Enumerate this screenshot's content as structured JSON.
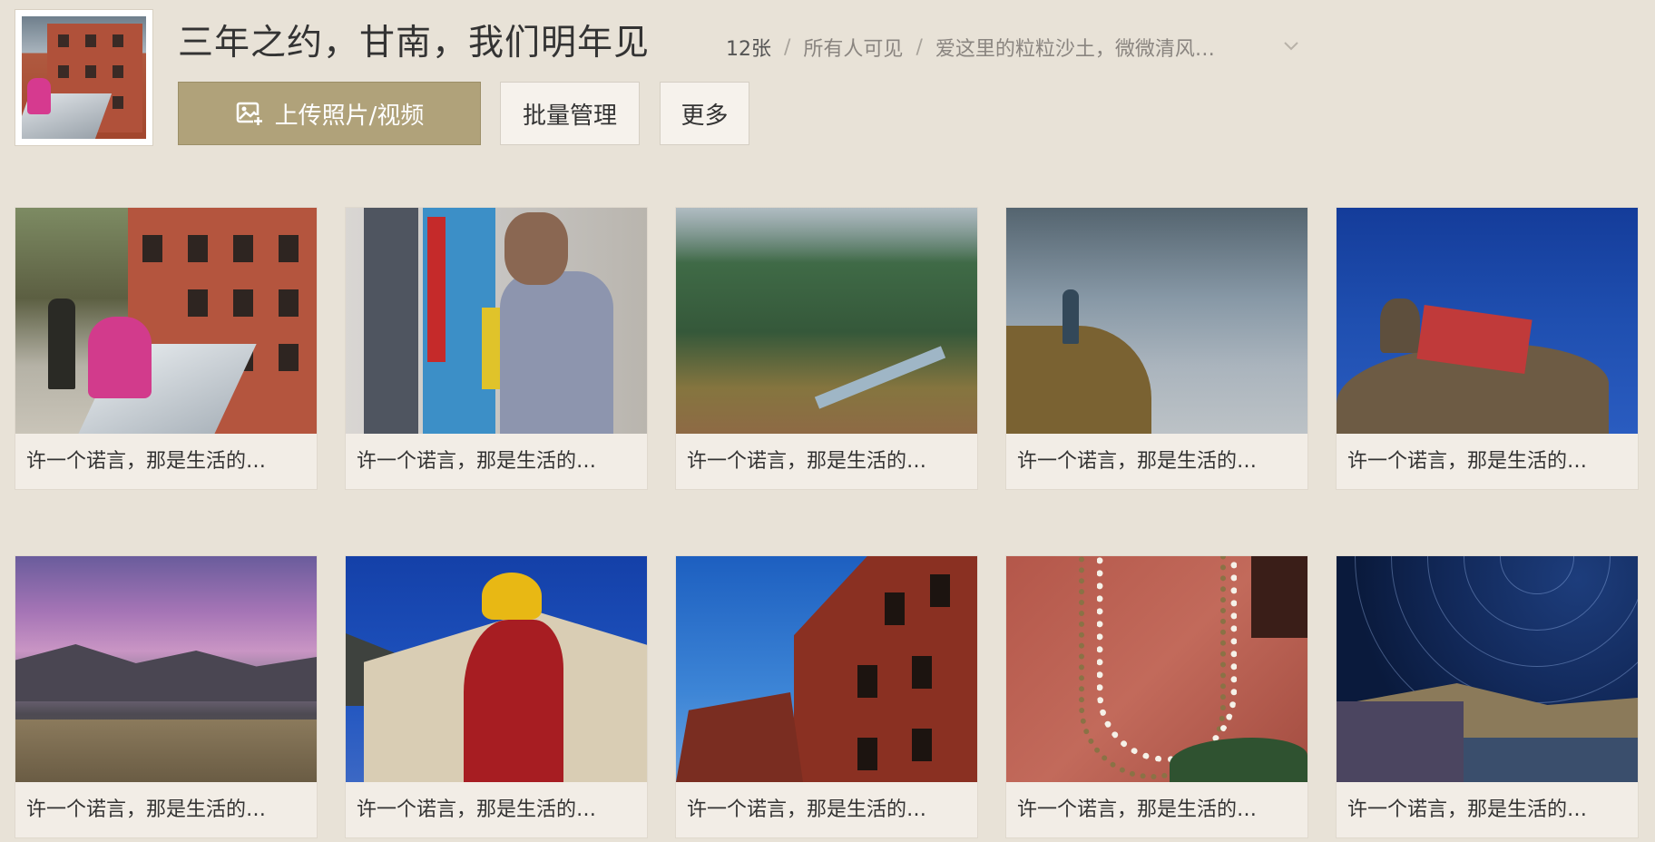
{
  "album": {
    "title": "三年之约，甘南，我们明年见",
    "count": "12张",
    "visibility": "所有人可见",
    "description": "爱这里的粒粒沙土，微微清风…",
    "separator": "/"
  },
  "toolbar": {
    "upload_label": "上传照片/视频",
    "batch_label": "批量管理",
    "more_label": "更多"
  },
  "colors": {
    "background": "#e8e2d7",
    "accent": "#b0a27a"
  },
  "photos": [
    {
      "caption": "许一个诺言，那是生活的…"
    },
    {
      "caption": "许一个诺言，那是生活的…"
    },
    {
      "caption": "许一个诺言，那是生活的…"
    },
    {
      "caption": "许一个诺言，那是生活的…"
    },
    {
      "caption": "许一个诺言，那是生活的…"
    },
    {
      "caption": "许一个诺言，那是生活的…"
    },
    {
      "caption": "许一个诺言，那是生活的…"
    },
    {
      "caption": "许一个诺言，那是生活的…"
    },
    {
      "caption": "许一个诺言，那是生活的…"
    },
    {
      "caption": "许一个诺言，那是生活的…"
    }
  ]
}
